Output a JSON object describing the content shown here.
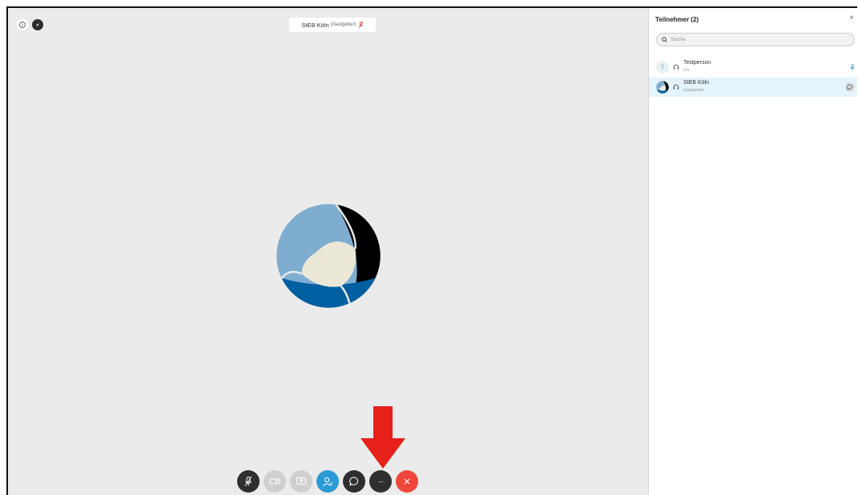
{
  "meeting": {
    "host_name": "StEB Köln",
    "host_role": "(Gastgeber)"
  },
  "panel": {
    "title": "Teilnehmer (2)",
    "close_glyph": "×",
    "search_placeholder": "Suche",
    "participants": [
      {
        "avatar_letter": "T",
        "name": "Testperson",
        "role": "Ich"
      },
      {
        "name": "StEB Köln",
        "role": "Gastgeber"
      }
    ]
  },
  "toolbar": {
    "buttons": [
      {
        "icon": "mic-muted-icon"
      },
      {
        "icon": "video-off-icon"
      },
      {
        "icon": "share-icon"
      },
      {
        "icon": "participants-icon"
      },
      {
        "icon": "chat-icon"
      },
      {
        "icon": "more-options-icon",
        "glyph": "···"
      },
      {
        "icon": "end-call-icon",
        "glyph": "×"
      }
    ]
  },
  "colors": {
    "stage_bg": "#ebebeb",
    "accent_blue": "#2a9ad6",
    "end_red": "#f0463c",
    "annotation_arrow": "#e8201a",
    "logo_light_blue": "#7eadd0",
    "logo_dark_blue": "#005fa0",
    "logo_cream": "#ece8d8",
    "logo_black": "#000000"
  }
}
